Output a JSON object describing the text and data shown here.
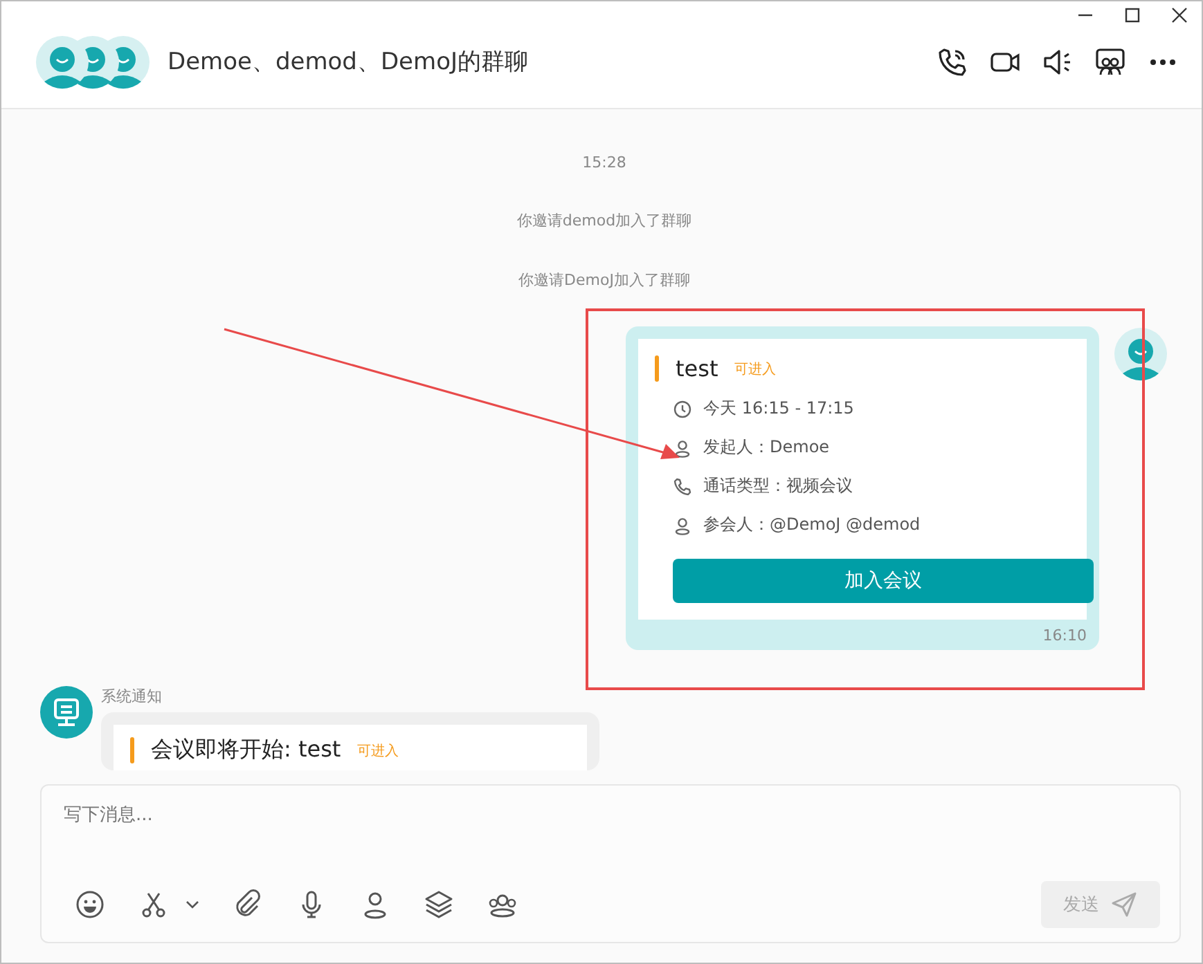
{
  "header": {
    "title": "Demoe、demod、DemoJ的群聊"
  },
  "messages": [
    {
      "kind": "time",
      "text": "15:28"
    },
    {
      "kind": "system",
      "text": "你邀请demod加入了群聊"
    },
    {
      "kind": "system",
      "text": "你邀请DemoJ加入了群聊"
    },
    {
      "kind": "meeting",
      "mine": true,
      "title": "test",
      "status": "可进入",
      "rows": [
        {
          "kind": "clock",
          "text": "今天 16:15 - 17:15"
        },
        {
          "kind": "person",
          "text": "发起人：Demoe"
        },
        {
          "kind": "phone",
          "text": "通话类型：视频会议"
        },
        {
          "kind": "person",
          "text": "参会人：@DemoJ @demod"
        }
      ],
      "button": "加入会议",
      "time": "16:10"
    },
    {
      "kind": "notice",
      "sender": "系统通知",
      "title": "会议即将开始: test",
      "status": "可进入"
    }
  ],
  "composer": {
    "placeholder": "写下消息...",
    "send": "发送",
    "send_disabled": true
  }
}
